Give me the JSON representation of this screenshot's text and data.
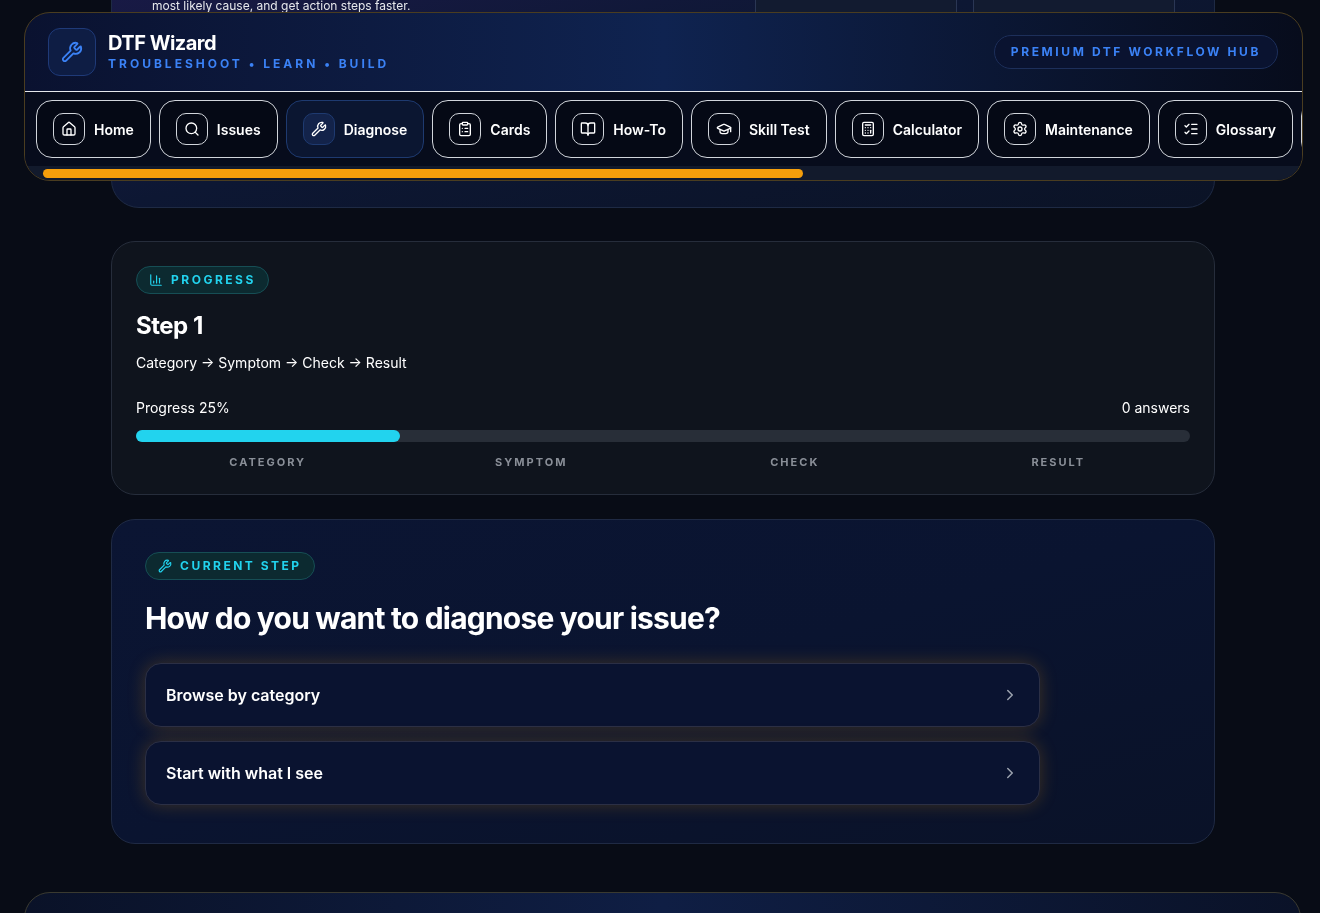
{
  "hero": {
    "text": "most likely cause, and get action steps faster."
  },
  "header": {
    "title": "DTF Wizard",
    "tagline": "TROUBLESHOOT • LEARN • BUILD",
    "badge": "PREMIUM DTF WORKFLOW HUB"
  },
  "nav": [
    {
      "label": "Home",
      "selected": false
    },
    {
      "label": "Issues",
      "selected": false
    },
    {
      "label": "Diagnose",
      "selected": true
    },
    {
      "label": "Cards",
      "selected": false
    },
    {
      "label": "How-To",
      "selected": false
    },
    {
      "label": "Skill Test",
      "selected": false
    },
    {
      "label": "Calculator",
      "selected": false
    },
    {
      "label": "Maintenance",
      "selected": false
    },
    {
      "label": "Glossary",
      "selected": false
    }
  ],
  "progress": {
    "tag": "PROGRESS",
    "title": "Step 1",
    "flow": "Category → Symptom → Check → Result",
    "label": "Progress 25%",
    "answers": "0 answers",
    "level": 0.25,
    "steps": [
      "CATEGORY",
      "SYMPTOM",
      "CHECK",
      "RESULT"
    ]
  },
  "current_step": {
    "tag": "CURRENT STEP",
    "question": "How do you want to diagnose your issue?",
    "options": [
      "Browse by category",
      "Start with what I see"
    ]
  }
}
